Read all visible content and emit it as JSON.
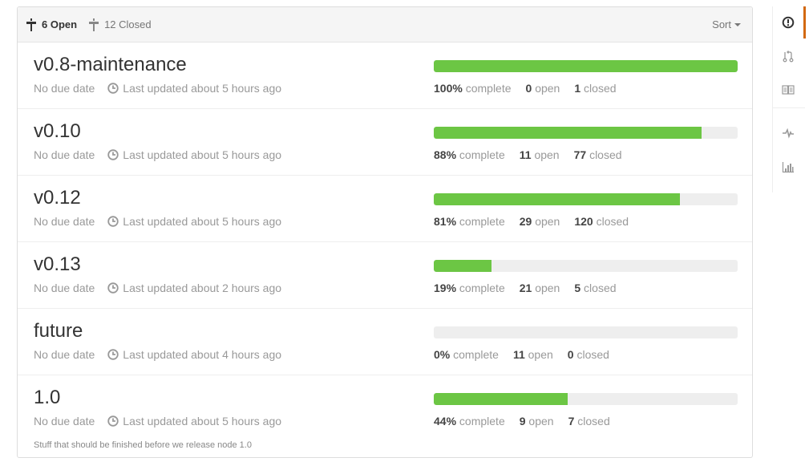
{
  "header": {
    "open_label": "6 Open",
    "closed_label": "12 Closed",
    "sort_label": "Sort",
    "open_icon": "milestone-icon",
    "closed_icon": "milestone-icon"
  },
  "milestones": [
    {
      "title": "v0.8-maintenance",
      "due": "No due date",
      "updated": "Last updated about 5 hours ago",
      "percent": 100,
      "percent_label": "100%",
      "complete_label": "complete",
      "open": "0",
      "open_label": "open",
      "closed": "1",
      "closed_label": "closed"
    },
    {
      "title": "v0.10",
      "due": "No due date",
      "updated": "Last updated about 5 hours ago",
      "percent": 88,
      "percent_label": "88%",
      "complete_label": "complete",
      "open": "11",
      "open_label": "open",
      "closed": "77",
      "closed_label": "closed"
    },
    {
      "title": "v0.12",
      "due": "No due date",
      "updated": "Last updated about 5 hours ago",
      "percent": 81,
      "percent_label": "81%",
      "complete_label": "complete",
      "open": "29",
      "open_label": "open",
      "closed": "120",
      "closed_label": "closed"
    },
    {
      "title": "v0.13",
      "due": "No due date",
      "updated": "Last updated about 2 hours ago",
      "percent": 19,
      "percent_label": "19%",
      "complete_label": "complete",
      "open": "21",
      "open_label": "open",
      "closed": "5",
      "closed_label": "closed"
    },
    {
      "title": "future",
      "due": "No due date",
      "updated": "Last updated about 4 hours ago",
      "percent": 0,
      "percent_label": "0%",
      "complete_label": "complete",
      "open": "11",
      "open_label": "open",
      "closed": "0",
      "closed_label": "closed"
    },
    {
      "title": "1.0",
      "due": "No due date",
      "updated": "Last updated about 5 hours ago",
      "percent": 44,
      "percent_label": "44%",
      "complete_label": "complete",
      "open": "9",
      "open_label": "open",
      "closed": "7",
      "closed_label": "closed",
      "description": "Stuff that should be finished before we release node 1.0"
    }
  ],
  "sidenav": {
    "items": [
      "issues-icon",
      "pull-requests-icon",
      "wiki-icon",
      "pulse-icon",
      "graphs-icon"
    ],
    "selected": "issues-icon",
    "accent": "#d26911"
  },
  "colors": {
    "progress_fill": "#6cc644",
    "progress_track": "#eeeeee"
  }
}
